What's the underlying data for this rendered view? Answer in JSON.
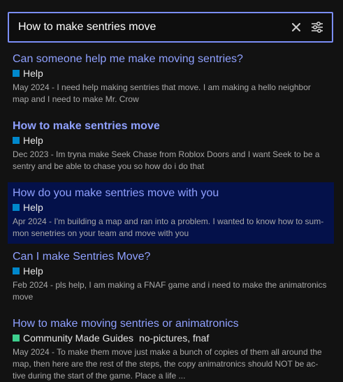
{
  "search": {
    "value": "How to make sentries move",
    "clear_icon": "close-icon",
    "filter_icon": "sliders-icon"
  },
  "colors": {
    "accent_border": "#7b8ef7",
    "link": "#8fa0ff",
    "highlight_bg": "#04114a",
    "help_category": "#0088cc",
    "guides_category": "#3ecf8e"
  },
  "results": [
    {
      "title": "Can someone help me make moving sentries?",
      "category": "Help",
      "category_color": "#0088cc",
      "tags": "",
      "excerpt_line1": "May 2024 - I need help making sentries that move. I am making a hello neighbor",
      "excerpt_line2": "map and I need to make Mr. Crow",
      "excerpt_line3": ""
    },
    {
      "title": "How to make sentries move",
      "category": "Help",
      "category_color": "#0088cc",
      "tags": "",
      "excerpt_line1": "Dec 2023 - Im tryna make Seek Chase from Roblox Doors and I want Seek to be a",
      "excerpt_line2": "sentry and be able to chase you so how do i do that",
      "excerpt_line3": ""
    },
    {
      "title": "How do you make sentries move with you",
      "category": "Help",
      "category_color": "#0088cc",
      "tags": "",
      "excerpt_line1": "Apr 2024 - I'm building a map and ran into a problem. I wanted to know how to sum-",
      "excerpt_line2": "mon senetries on your team and move with you",
      "excerpt_line3": ""
    },
    {
      "title": "Can I make Sentries Move?",
      "category": "Help",
      "category_color": "#0088cc",
      "tags": "",
      "excerpt_line1": "Feb 2024 - pls help, I am making a FNAF game and i need to make the animatronics",
      "excerpt_line2": "move",
      "excerpt_line3": ""
    },
    {
      "title": "How to make moving sentries or animatronics",
      "category": "Community Made Guides",
      "category_color": "#3ecf8e",
      "tags": "no-pictures, fnaf",
      "excerpt_line1": "May 2024 - To make them move just make a bunch of copies of them all around the",
      "excerpt_line2": "map, then here are the rest of the steps, the copy animatronics should NOT be ac-",
      "excerpt_line3": "tive during the start of the game. Place a life ..."
    }
  ]
}
